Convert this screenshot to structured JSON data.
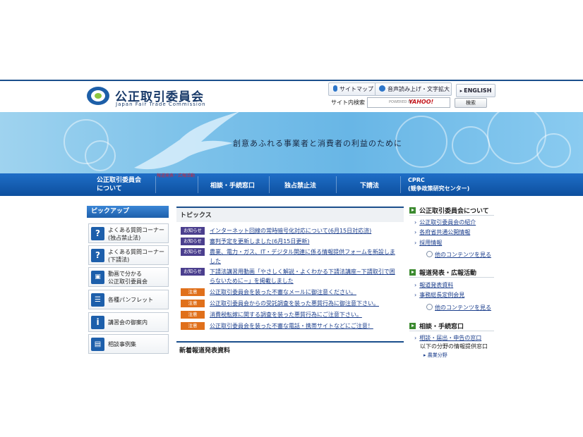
{
  "header": {
    "logo_title": "公正取引委員会",
    "logo_subtitle": "Japan Fair Trade Commission",
    "sitemap_label": "サイトマップ",
    "voice_label": "音声読み上げ・文字拡大",
    "english_label": "ENGLISH",
    "search_label": "サイト内検索",
    "search_powered": "POWERED BY",
    "search_provider": "YAHOO!",
    "search_button": "検索"
  },
  "banner": {
    "tagline": "創意あふれる事業者と消費者の利益のために"
  },
  "nav": {
    "items": [
      {
        "label": "公正取引委員会\nについて"
      },
      {
        "label": "相談・手続窓口"
      },
      {
        "label": "独占禁止法"
      },
      {
        "label": "下請法"
      },
      {
        "label": "CPRC\n(競争政策研究センター)"
      }
    ],
    "broken_image_alt": "報道発表・広報活動"
  },
  "pickup": {
    "title": "ピックアップ",
    "items": [
      {
        "icon": "question-icon",
        "label": "よくある質問コーナー\n(独占禁止法)"
      },
      {
        "icon": "question-icon",
        "label": "よくある質問コーナー\n(下請法)"
      },
      {
        "icon": "film-icon",
        "label": "動画で分かる\n公正取引委員会"
      },
      {
        "icon": "layers-icon",
        "label": "各種パンフレット"
      },
      {
        "icon": "info-icon",
        "label": "講習会の御案内"
      },
      {
        "icon": "document-icon",
        "label": "相談事例集"
      }
    ]
  },
  "topics": {
    "title": "トピックス",
    "items": [
      {
        "badge": "お知らせ",
        "type": "info",
        "text": "インターネット回線の常時暗号化対応について(6月15日対応済)"
      },
      {
        "badge": "お知らせ",
        "type": "info",
        "text": "審判予定を更新しました(6月15日更新)"
      },
      {
        "badge": "お知らせ",
        "type": "info",
        "text": "農業、電力・ガス、IT・デジタル関連に係る情報提供フォームを新設しました"
      },
      {
        "badge": "お知らせ",
        "type": "info",
        "text": "下請法講習用動画「やさしく解説・よくわかる下請法講座~下請取引で困らないために~」を掲載しました"
      },
      {
        "badge": "注意",
        "type": "warn",
        "text": "公正取引委員会を装った不審なメールに御注意ください。"
      },
      {
        "badge": "注意",
        "type": "warn",
        "text": "公正取引委員会からの受託調査を装った悪質行為に御注意下さい。"
      },
      {
        "badge": "注意",
        "type": "warn",
        "text": "消費税転嫁に関する調査を装った悪質行為にご注意下さい。"
      },
      {
        "badge": "注意",
        "type": "warn",
        "text": "公正取引委員会を装った不審な電話・携帯サイトなどにご注意！"
      }
    ],
    "press_title": "新着報道発表資料"
  },
  "right": {
    "about_title": "公正取引委員会について",
    "about_links": [
      "公正取引委員会の紹介",
      "各府省共通公開情報",
      "採用情報"
    ],
    "about_more": "他のコンテンツを見る",
    "press_title": "報道発表・広報活動",
    "press_links": [
      "報道発表資料",
      "事務総長定例会見"
    ],
    "press_more": "他のコンテンツを見る",
    "consult_title": "相談・手続窓口",
    "consult_links": [
      "相談・届出・申告の窓口"
    ],
    "consult_text": "以下の分野の情報提供窓口",
    "consult_sub": "農業分野"
  },
  "colors": {
    "brand": "#1b4f8c",
    "nav": "#1565c0",
    "info_badge": "#4b3f8e",
    "warn_badge": "#e0701b",
    "section_marker": "#3b8a2f"
  }
}
